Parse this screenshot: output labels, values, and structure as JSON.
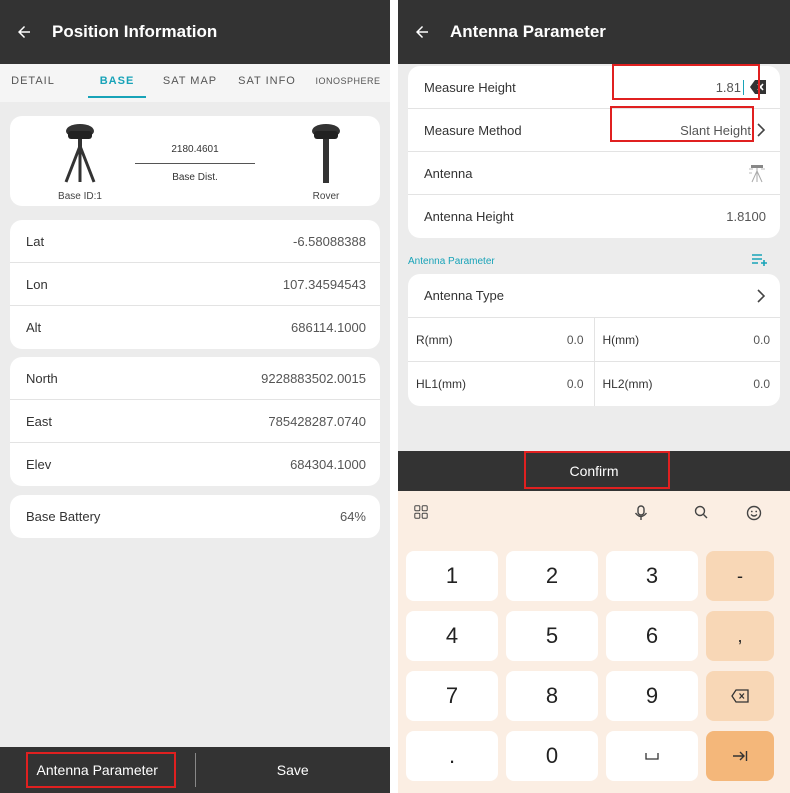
{
  "left": {
    "title": "Position Information",
    "tabs": [
      "DETAIL",
      "BASE",
      "SAT MAP",
      "SAT INFO",
      "IONOSPHERE"
    ],
    "active_tab": "BASE",
    "base_card": {
      "distance": "2180.4601",
      "dist_label": "Base Dist.",
      "base_label": "Base ID:1",
      "rover_label": "Rover"
    },
    "coords": [
      {
        "label": "Lat",
        "value": "-6.58088388"
      },
      {
        "label": "Lon",
        "value": "107.34594543"
      },
      {
        "label": "Alt",
        "value": "686114.1000"
      }
    ],
    "grid": [
      {
        "label": "North",
        "value": "9228883502.0015"
      },
      {
        "label": "East",
        "value": "785428287.0740"
      },
      {
        "label": "Elev",
        "value": "684304.1000"
      }
    ],
    "battery": {
      "label": "Base Battery",
      "value": "64%"
    },
    "buttons": {
      "antenna": "Antenna Parameter",
      "save": "Save"
    }
  },
  "right": {
    "title": "Antenna Parameter",
    "fields": {
      "measure_height_label": "Measure Height",
      "measure_height_value": "1.81",
      "measure_method_label": "Measure Method",
      "measure_method_value": "Slant Height",
      "antenna_label": "Antenna",
      "antenna_height_label": "Antenna Height",
      "antenna_height_value": "1.8100"
    },
    "section_label": "Antenna Parameter",
    "antenna_type_label": "Antenna Type",
    "params": [
      [
        {
          "label": "R(mm)",
          "value": "0.0"
        },
        {
          "label": "H(mm)",
          "value": "0.0"
        }
      ],
      [
        {
          "label": "HL1(mm)",
          "value": "0.0"
        },
        {
          "label": "HL2(mm)",
          "value": "0.0"
        }
      ]
    ],
    "confirm_label": "Confirm",
    "keys": {
      "k1": "1",
      "k2": "2",
      "k3": "3",
      "k4": "4",
      "k5": "5",
      "k6": "6",
      "k7": "7",
      "k8": "8",
      "k9": "9",
      "k0": "0",
      "dot": ".",
      "minus": "-",
      "comma": ","
    }
  },
  "icons": {
    "back": "arrow-left-icon",
    "clear": "backspace-icon",
    "chevron": "chevron-right-icon",
    "add_list": "playlist-add-icon",
    "grid": "apps-grid-icon",
    "mic": "microphone-icon",
    "search": "search-icon",
    "emoji": "emoji-icon",
    "space": "space-bar-icon",
    "next": "tab-next-icon"
  },
  "colors": {
    "accent": "#18a3b8",
    "appbar": "#333333",
    "highlight": "#e02020",
    "keyboard_bg": "#fbeee3"
  }
}
